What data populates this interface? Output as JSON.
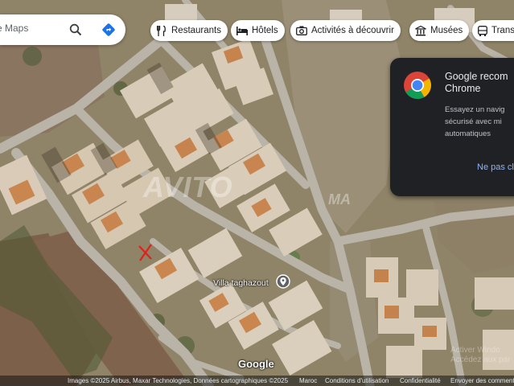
{
  "search": {
    "placeholder": "e Maps"
  },
  "chips": [
    {
      "label": "Restaurants",
      "icon": "fork-knife-icon"
    },
    {
      "label": "Hôtels",
      "icon": "bed-icon"
    },
    {
      "label": "Activités à découvrir",
      "icon": "camera-icon"
    },
    {
      "label": "Musées",
      "icon": "museum-icon"
    },
    {
      "label": "Transports",
      "icon": "bus-icon"
    }
  ],
  "promo": {
    "title_line1": "Google recom",
    "title_line2": "Chrome",
    "body_line1": "Essayez un navig",
    "body_line2": "sécurisé avec mi",
    "body_line3": "automatiques",
    "dismiss": "Ne pas cl"
  },
  "map": {
    "place_label": "Villa taghazout",
    "google_logo": "Google",
    "watermark": "AVITO",
    "watermark_tail": "MA",
    "windows_line1": "Activer Windo",
    "windows_line2": "Accédez aux par"
  },
  "footer": {
    "attribution": "Images ©2025 Airbus, Maxar Technologies, Données cartographiques ©2025",
    "region": "Maroc",
    "terms": "Conditions d'utilisation",
    "privacy": "Confidentialité",
    "feedback": "Envoyer des commentaires"
  },
  "colors": {
    "chrome_red": "#db4437",
    "chrome_green": "#0f9d58",
    "chrome_yellow": "#f4b400",
    "chrome_blue": "#4285f4",
    "link_blue": "#8ab4f8",
    "card_bg": "#202124"
  }
}
